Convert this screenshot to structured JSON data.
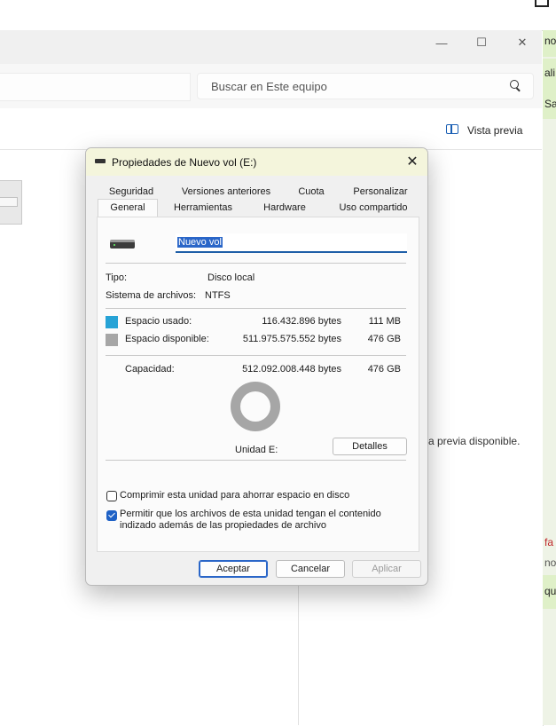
{
  "explorer": {
    "search_placeholder": "Buscar en Este equipo",
    "preview_label": "Vista previa",
    "no_preview_text": "a previa disponible.",
    "window_buttons": {
      "minimize": "—",
      "maximize": "☐",
      "close": "✕"
    }
  },
  "chat_fragments": [
    "no",
    "ali",
    "Sal",
    "fa",
    "no",
    "qu"
  ],
  "dialog": {
    "title": "Propiedades de Nuevo vol (E:)",
    "close": "✕",
    "tabs_row1": [
      "Seguridad",
      "Versiones anteriores",
      "Cuota",
      "Personalizar"
    ],
    "tabs_row2": [
      "General",
      "Herramientas",
      "Hardware",
      "Uso compartido"
    ],
    "active_tab": "General",
    "volume_name": "Nuevo vol",
    "type_label": "Tipo:",
    "type_value": "Disco local",
    "fs_label": "Sistema de archivos:",
    "fs_value": "NTFS",
    "used_label": "Espacio usado:",
    "used_bytes": "116.432.896 bytes",
    "used_size": "111 MB",
    "free_label": "Espacio disponible:",
    "free_bytes": "511.975.575.552 bytes",
    "free_size": "476 GB",
    "capacity_label": "Capacidad:",
    "capacity_bytes": "512.092.008.448 bytes",
    "capacity_size": "476 GB",
    "unit_label": "Unidad E:",
    "details_button": "Detalles",
    "compress_label": "Comprimir esta unidad para ahorrar espacio en disco",
    "compress_checked": false,
    "index_label_line1": "Permitir que los archivos de esta unidad tengan el contenido",
    "index_label_line2": "indizado además de las propiedades de archivo",
    "index_checked": true,
    "ok_button": "Aceptar",
    "cancel_button": "Cancelar",
    "apply_button": "Aplicar",
    "colors": {
      "used": "#27a3d6",
      "free": "#a6a6a6",
      "accent": "#2a66c8"
    },
    "used_fraction": 0.000227
  }
}
